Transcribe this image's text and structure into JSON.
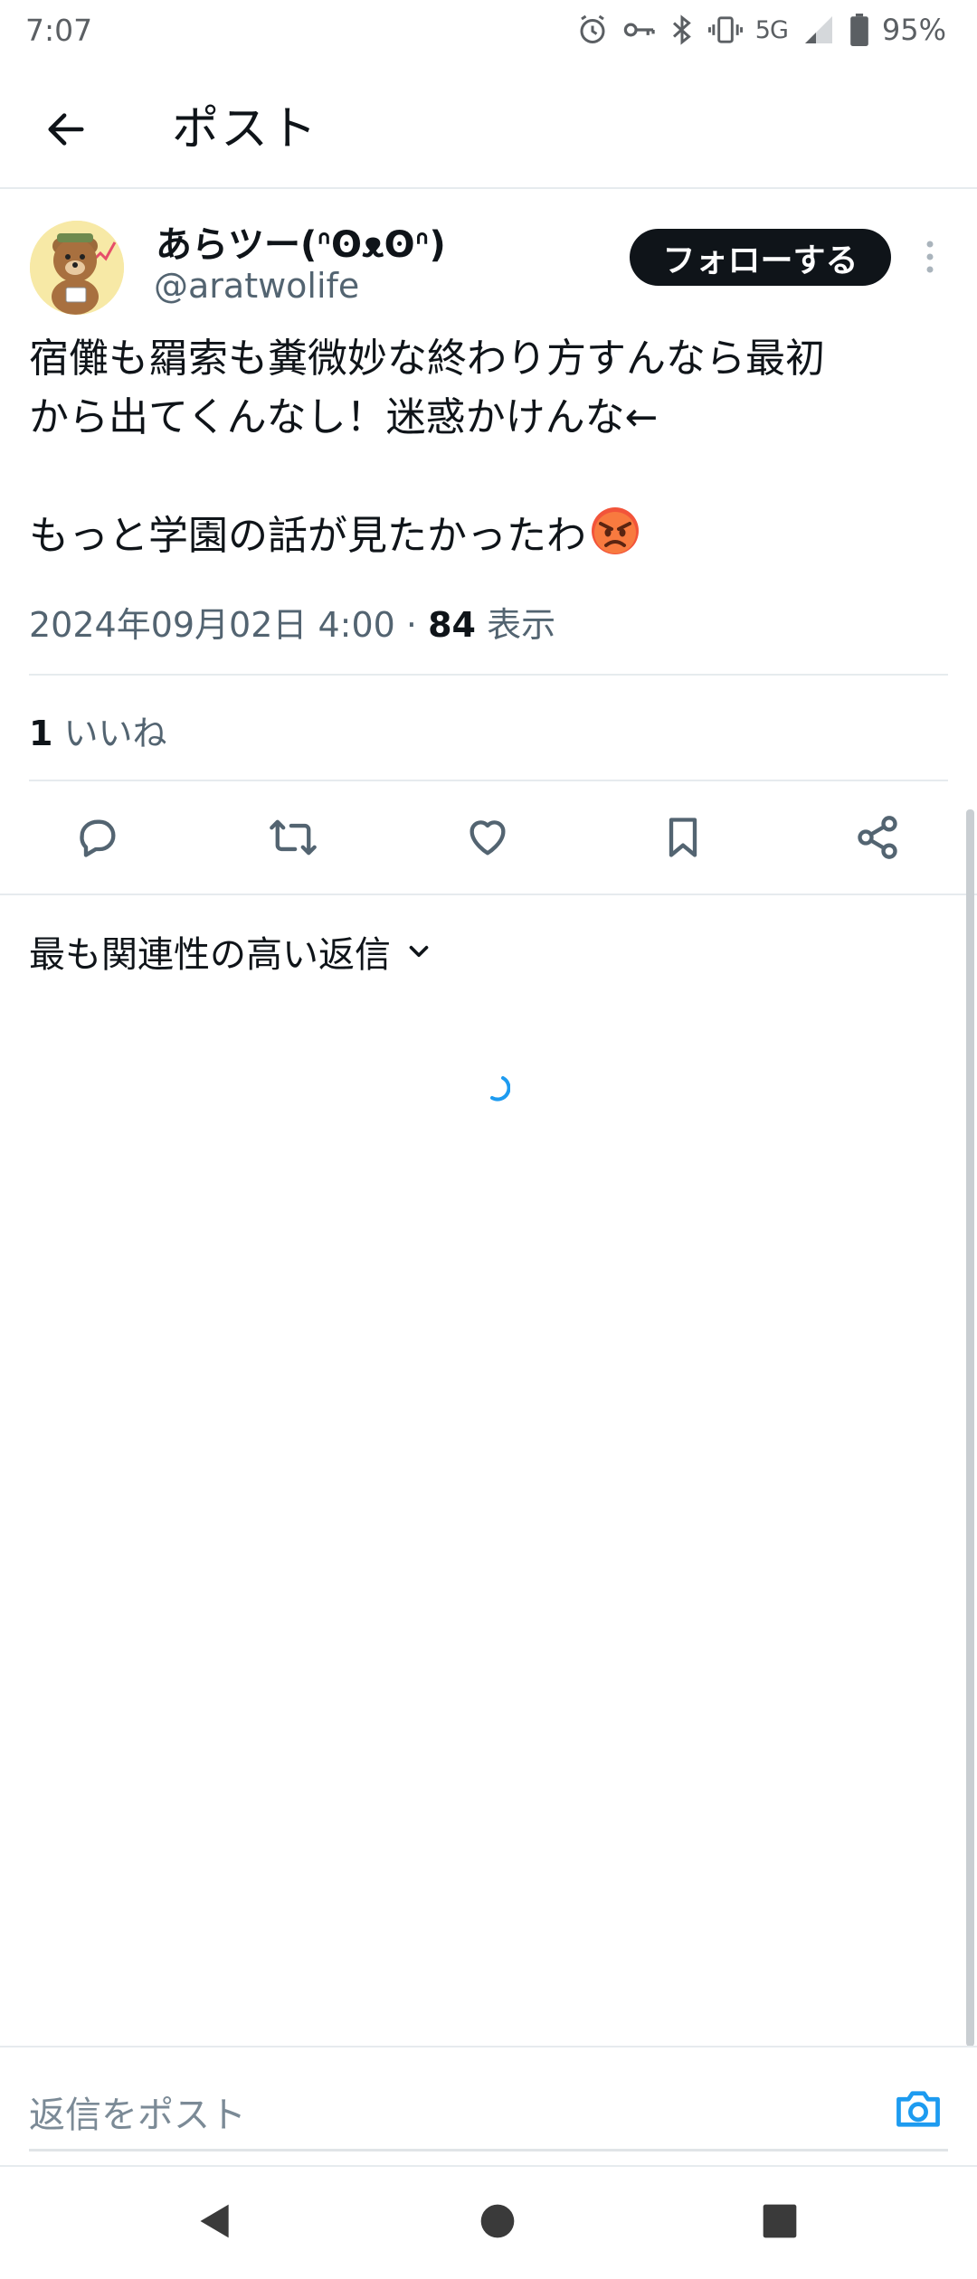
{
  "status_bar": {
    "time": "7:07",
    "network": "5G",
    "battery": "95%",
    "icons": [
      "alarm-icon",
      "vpn-key-icon",
      "bluetooth-icon",
      "vibrate-icon",
      "signal-icon",
      "battery-icon"
    ]
  },
  "app_bar": {
    "title": "ポスト"
  },
  "post": {
    "display_name": "あらツー(ᐢʘᴥʘᐢ)",
    "handle": "@aratwolife",
    "follow_label": "フォローする",
    "body_line1": "宿儺も羂索も糞微妙な終わり方すんなら最初",
    "body_line2": "から出てくんなし！迷惑かけんな←",
    "body_line3": "もっと学園の話が見たかったわ",
    "emoji": "angry-face-icon",
    "timestamp": "2024年09月02日 4:00",
    "separator": "·",
    "views_count": "84",
    "views_label": "表示",
    "likes_count": "1",
    "likes_label": "いいね"
  },
  "replies": {
    "sort_label": "最も関連性の高い返信"
  },
  "reply_bar": {
    "placeholder": "返信をポスト"
  },
  "colors": {
    "follow_bg": "#0f1419",
    "secondary_text": "#536471",
    "accent_blue": "#1d9bf0",
    "divider": "#e6ebee"
  }
}
